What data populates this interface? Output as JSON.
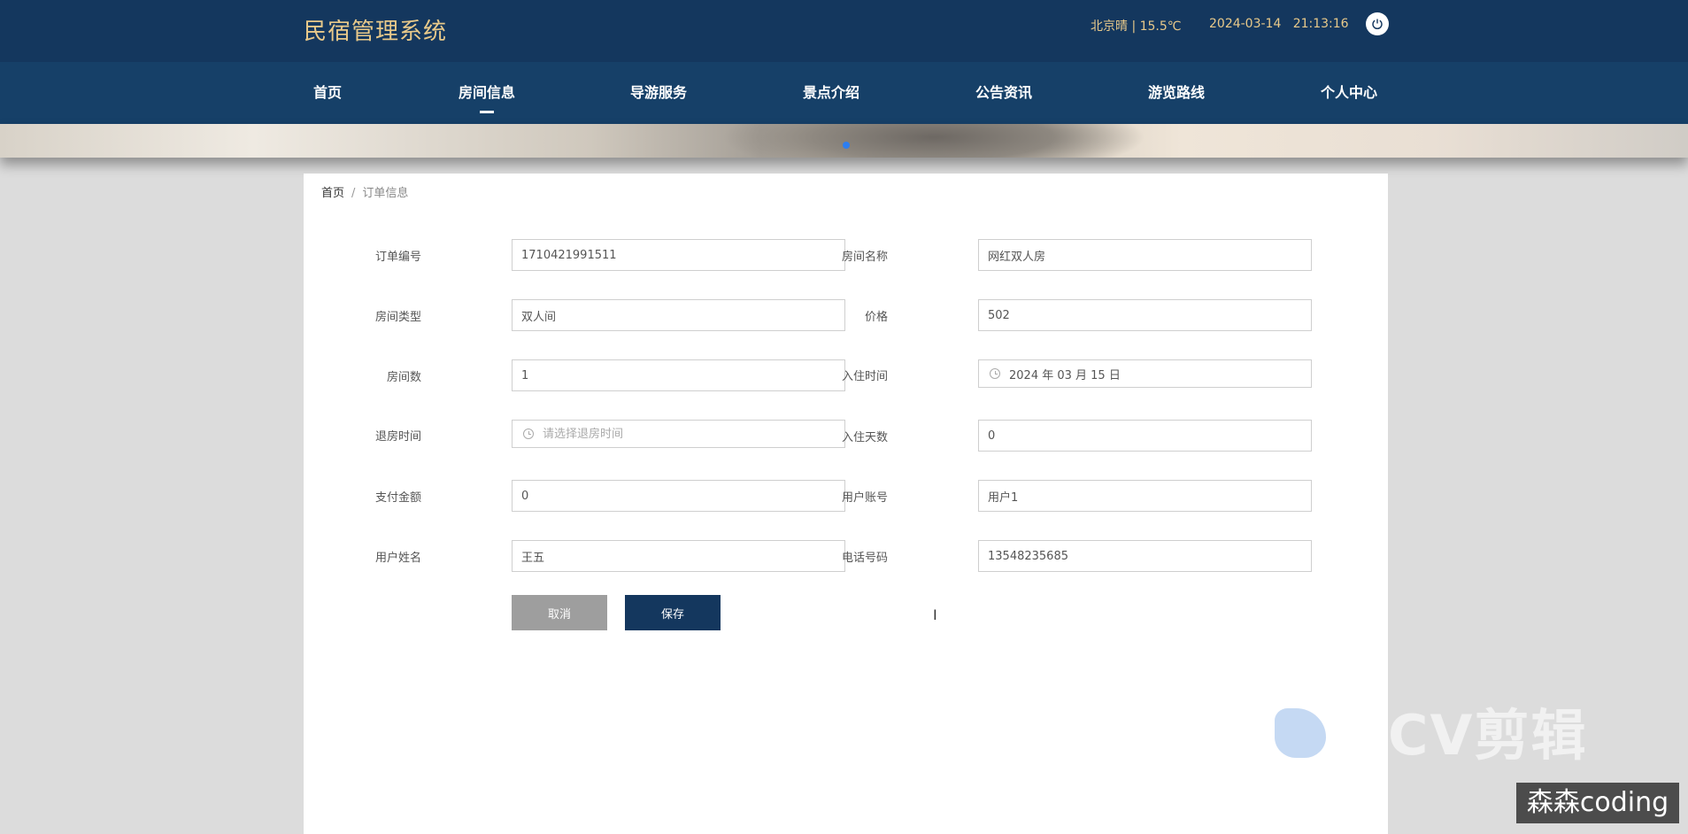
{
  "header": {
    "app_title": "民宿管理系统",
    "weather": "北京晴 | 15.5℃",
    "datetime": "2024-03-14   21:13:16"
  },
  "nav": {
    "items": [
      {
        "label": "首页"
      },
      {
        "label": "房间信息",
        "active": true
      },
      {
        "label": "导游服务"
      },
      {
        "label": "景点介绍"
      },
      {
        "label": "公告资讯"
      },
      {
        "label": "游览路线"
      },
      {
        "label": "个人中心"
      }
    ]
  },
  "breadcrumb": {
    "home": "首页",
    "separator": "/",
    "current": "订单信息"
  },
  "form": {
    "order_no": {
      "label": "订单编号",
      "value": "1710421991511"
    },
    "room_name": {
      "label": "房间名称",
      "value": "网红双人房"
    },
    "room_type": {
      "label": "房间类型",
      "value": "双人间"
    },
    "price": {
      "label": "价格",
      "value": "502"
    },
    "room_count": {
      "label": "房间数",
      "value": "1"
    },
    "checkin_time": {
      "label": "入住时间",
      "value": "2024 年 03 月 15 日"
    },
    "checkout_time": {
      "label": "退房时间",
      "value": "",
      "placeholder": "请选择退房时间"
    },
    "stay_days": {
      "label": "入住天数",
      "value": "0"
    },
    "pay_amount": {
      "label": "支付金额",
      "value": "0"
    },
    "user_account": {
      "label": "用户账号",
      "value": "用户1"
    },
    "user_name": {
      "label": "用户姓名",
      "value": "王五"
    },
    "phone": {
      "label": "电话号码",
      "value": "13548235685"
    }
  },
  "buttons": {
    "cancel": "取消",
    "save": "保存"
  },
  "watermark": {
    "logo_text": "CV剪辑",
    "author": "森森coding"
  }
}
